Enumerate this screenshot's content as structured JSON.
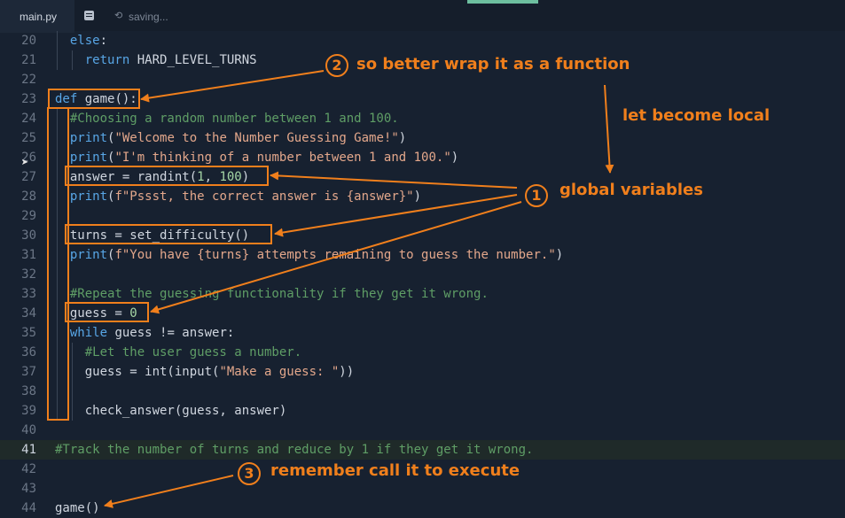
{
  "tab": {
    "filename": "main.py",
    "status": "saving..."
  },
  "icons": {
    "file": "file-icon",
    "sync": "sync-icon",
    "cursor": "mouse-pointer-icon"
  },
  "colors": {
    "annotation": "#f07f1c",
    "keyword": "#58a6e6",
    "string": "#e3a78b",
    "comment": "#5f9e66",
    "number": "#a6d7a6",
    "background": "#172130"
  },
  "lines": [
    {
      "n": "20",
      "tokens": [
        [
          "",
          "  "
        ],
        [
          "kw",
          "else"
        ],
        [
          "",
          ":"
        ]
      ]
    },
    {
      "n": "21",
      "tokens": [
        [
          "",
          "    "
        ],
        [
          "kw",
          "return"
        ],
        [
          "",
          " HARD_LEVEL_TURNS"
        ]
      ]
    },
    {
      "n": "22",
      "tokens": []
    },
    {
      "n": "23",
      "tokens": [
        [
          "kw",
          "def"
        ],
        [
          "",
          " game():"
        ]
      ]
    },
    {
      "n": "24",
      "tokens": [
        [
          "",
          "  "
        ],
        [
          "cmt",
          "#Choosing a random number between 1 and 100."
        ]
      ]
    },
    {
      "n": "25",
      "tokens": [
        [
          "",
          "  "
        ],
        [
          "kw",
          "print"
        ],
        [
          "",
          "("
        ],
        [
          "str",
          "\"Welcome to the Number Guessing Game!\""
        ],
        [
          "",
          ")"
        ]
      ]
    },
    {
      "n": "26",
      "tokens": [
        [
          "",
          "  "
        ],
        [
          "kw",
          "print"
        ],
        [
          "",
          "("
        ],
        [
          "str",
          "\"I'm thinking of a number between 1 and 100.\""
        ],
        [
          "",
          ")"
        ]
      ]
    },
    {
      "n": "27",
      "tokens": [
        [
          "",
          "  answer = randint("
        ],
        [
          "num",
          "1"
        ],
        [
          "",
          ", "
        ],
        [
          "num",
          "100"
        ],
        [
          "",
          ")"
        ]
      ]
    },
    {
      "n": "28",
      "tokens": [
        [
          "",
          "  "
        ],
        [
          "kw",
          "print"
        ],
        [
          "",
          "("
        ],
        [
          "str",
          "f\"Pssst, the correct answer is {answer}\""
        ],
        [
          "",
          ")"
        ]
      ]
    },
    {
      "n": "29",
      "tokens": []
    },
    {
      "n": "30",
      "tokens": [
        [
          "",
          "  turns = set_difficulty()"
        ]
      ]
    },
    {
      "n": "31",
      "tokens": [
        [
          "",
          "  "
        ],
        [
          "kw",
          "print"
        ],
        [
          "",
          "("
        ],
        [
          "str",
          "f\"You have {turns} attempts remaining to guess the number.\""
        ],
        [
          "",
          ")"
        ]
      ]
    },
    {
      "n": "32",
      "tokens": []
    },
    {
      "n": "33",
      "tokens": [
        [
          "",
          "  "
        ],
        [
          "cmt",
          "#Repeat the guessing functionality if they get it wrong."
        ]
      ]
    },
    {
      "n": "34",
      "tokens": [
        [
          "",
          "  guess = "
        ],
        [
          "num",
          "0"
        ]
      ]
    },
    {
      "n": "35",
      "tokens": [
        [
          "",
          "  "
        ],
        [
          "kw",
          "while"
        ],
        [
          "",
          " guess != answer:"
        ]
      ]
    },
    {
      "n": "36",
      "tokens": [
        [
          "",
          "    "
        ],
        [
          "cmt",
          "#Let the user guess a number."
        ]
      ]
    },
    {
      "n": "37",
      "tokens": [
        [
          "",
          "    guess = int(input("
        ],
        [
          "str",
          "\"Make a guess: \""
        ],
        [
          "",
          "))"
        ]
      ]
    },
    {
      "n": "38",
      "tokens": []
    },
    {
      "n": "39",
      "tokens": [
        [
          "",
          "    check_answer(guess, answer)"
        ]
      ]
    },
    {
      "n": "40",
      "tokens": []
    },
    {
      "n": "41",
      "tokens": [
        [
          "cmt",
          "#Track the number of turns and reduce by 1 if they get it wrong."
        ]
      ],
      "active": true
    },
    {
      "n": "42",
      "tokens": []
    },
    {
      "n": "43",
      "tokens": []
    },
    {
      "n": "44",
      "tokens": [
        [
          "",
          "game()"
        ]
      ]
    }
  ],
  "annotations": {
    "a1": {
      "num": "1",
      "text": "global variables"
    },
    "a2": {
      "num": "2",
      "text": "so better wrap it as a function"
    },
    "a3": {
      "num": "3",
      "text": "remember call it to execute"
    },
    "local": "let become local"
  }
}
